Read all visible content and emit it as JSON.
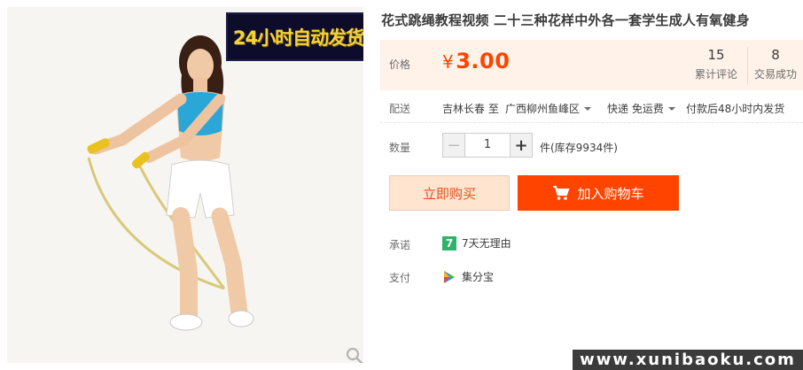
{
  "promo_banner": "24小时自动发货",
  "title": "花式跳绳教程视频 二十三种花样中外各一套学生成人有氧健身",
  "price": {
    "label": "价格",
    "currency": "¥",
    "amount": "3.00",
    "color": "#ff4400"
  },
  "stats": [
    {
      "value": "15",
      "caption": "累计评论"
    },
    {
      "value": "8",
      "caption": "交易成功"
    }
  ],
  "shipping": {
    "label": "配送",
    "from": "吉林长春 至",
    "to": "广西柳州鱼峰区",
    "method": "快递 免运费",
    "dispatch": "付款后48小时内发货"
  },
  "quantity": {
    "label": "数量",
    "value": "1",
    "unit_stock": "件(库存9934件)"
  },
  "buttons": {
    "buy_now": "立即购买",
    "add_cart": "加入购物车"
  },
  "promise": {
    "label": "承诺",
    "text": "7天无理由",
    "icon_text": "7"
  },
  "payment": {
    "label": "支付",
    "text": "集分宝"
  },
  "watermark": "www.xunibaoku.com"
}
